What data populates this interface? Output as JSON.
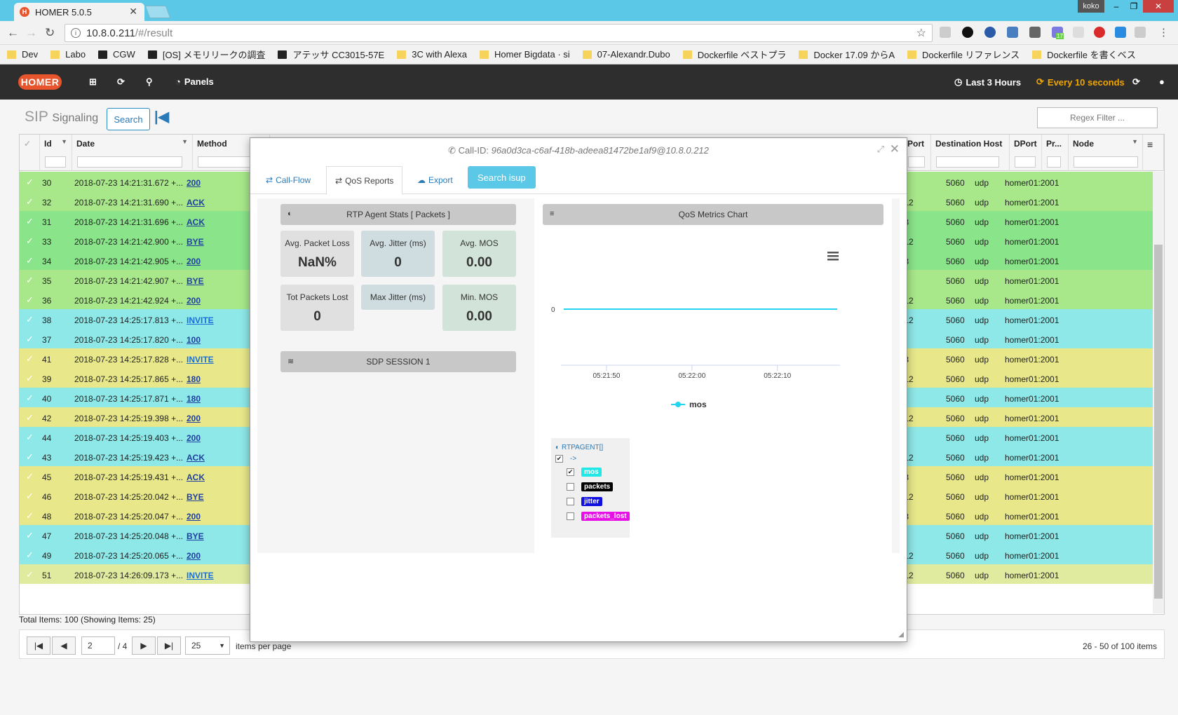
{
  "browser": {
    "tab_title": "HOMER 5.0.5",
    "tab_favicon": "H",
    "user": "koko",
    "url_host": "10.8.0.211",
    "url_path": "/#/result",
    "bookmarks": [
      "Dev",
      "Labo",
      "CGW",
      "[OS] メモリリークの調査",
      "アテッサ CC3015-57E",
      "3C with Alexa",
      "Homer Bigdata · si",
      "07-Alexandr.Dubo",
      "Dockerfile ベストプラ",
      "Docker 17.09 からA",
      "Dockerfile リファレンス",
      "Dockerfile を書くベス"
    ],
    "badge_count": "17"
  },
  "nav": {
    "logo": "HOMER",
    "panels": "Panels",
    "time_range": "Last 3 Hours",
    "refresh": "Every 10 seconds"
  },
  "page": {
    "title": "SIP",
    "subtitle": "Signaling",
    "search_button": "Search",
    "regex_placeholder": "Regex Filter ..."
  },
  "grid": {
    "columns": [
      "Id",
      "Date",
      "Method",
      "Port",
      "Destination Host",
      "DPort",
      "Pr...",
      "Node"
    ],
    "rows": [
      {
        "id": "30",
        "date": "2018-07-23 14:21:31.672 +...",
        "method": "200",
        "port": "060",
        "dhost": "10.8.1.2",
        "dport": "5060",
        "proto": "udp",
        "node": "homer01:2001",
        "color": "#a8e88a"
      },
      {
        "id": "32",
        "date": "2018-07-23 14:21:31.690 +...",
        "method": "ACK",
        "port": "060",
        "dhost": "10.8.0.212",
        "dport": "5060",
        "proto": "udp",
        "node": "homer01:2001",
        "color": "#a8e88a"
      },
      {
        "id": "31",
        "date": "2018-07-23 14:21:31.696 +...",
        "method": "ACK",
        "port": "060",
        "dhost": "10.8.1.58",
        "dport": "5060",
        "proto": "udp",
        "node": "homer01:2001",
        "color": "#8ae48a"
      },
      {
        "id": "33",
        "date": "2018-07-23 14:21:42.900 +...",
        "method": "BYE",
        "port": "5302",
        "dhost": "10.8.0.212",
        "dport": "5060",
        "proto": "udp",
        "node": "homer01:2001",
        "color": "#8ae48a"
      },
      {
        "id": "34",
        "date": "2018-07-23 14:21:42.905 +...",
        "method": "200",
        "port": "060",
        "dhost": "10.8.1.58",
        "dport": "5060",
        "proto": "udp",
        "node": "homer01:2001",
        "color": "#8ae48a"
      },
      {
        "id": "35",
        "date": "2018-07-23 14:21:42.907 +...",
        "method": "BYE",
        "port": "060",
        "dhost": "10.8.1.2",
        "dport": "5060",
        "proto": "udp",
        "node": "homer01:2001",
        "color": "#a8e88a"
      },
      {
        "id": "36",
        "date": "2018-07-23 14:21:42.924 +...",
        "method": "200",
        "port": "060",
        "dhost": "10.8.0.212",
        "dport": "5060",
        "proto": "udp",
        "node": "homer01:2001",
        "color": "#a8e88a"
      },
      {
        "id": "38",
        "date": "2018-07-23 14:25:17.813 +...",
        "method": "INVITE",
        "port": "060",
        "dhost": "10.8.0.212",
        "dport": "5060",
        "proto": "udp",
        "node": "homer01:2001",
        "color": "#8ee8e8"
      },
      {
        "id": "37",
        "date": "2018-07-23 14:25:17.820 +...",
        "method": "100",
        "port": "060",
        "dhost": "10.8.1.2",
        "dport": "5060",
        "proto": "udp",
        "node": "homer01:2001",
        "color": "#8ee8e8"
      },
      {
        "id": "41",
        "date": "2018-07-23 14:25:17.828 +...",
        "method": "INVITE",
        "port": "060",
        "dhost": "10.8.1.58",
        "dport": "5060",
        "proto": "udp",
        "node": "homer01:2001",
        "color": "#e8e88a"
      },
      {
        "id": "39",
        "date": "2018-07-23 14:25:17.865 +...",
        "method": "180",
        "port": "5302",
        "dhost": "10.8.0.212",
        "dport": "5060",
        "proto": "udp",
        "node": "homer01:2001",
        "color": "#e8e88a"
      },
      {
        "id": "40",
        "date": "2018-07-23 14:25:17.871 +...",
        "method": "180",
        "port": "060",
        "dhost": "10.8.1.2",
        "dport": "5060",
        "proto": "udp",
        "node": "homer01:2001",
        "color": "#8ee8e8"
      },
      {
        "id": "42",
        "date": "2018-07-23 14:25:19.398 +...",
        "method": "200",
        "port": "5302",
        "dhost": "10.8.0.212",
        "dport": "5060",
        "proto": "udp",
        "node": "homer01:2001",
        "color": "#e8e88a"
      },
      {
        "id": "44",
        "date": "2018-07-23 14:25:19.403 +...",
        "method": "200",
        "port": "060",
        "dhost": "10.8.1.2",
        "dport": "5060",
        "proto": "udp",
        "node": "homer01:2001",
        "color": "#8ee8e8"
      },
      {
        "id": "43",
        "date": "2018-07-23 14:25:19.423 +...",
        "method": "ACK",
        "port": "060",
        "dhost": "10.8.0.212",
        "dport": "5060",
        "proto": "udp",
        "node": "homer01:2001",
        "color": "#8ee8e8"
      },
      {
        "id": "45",
        "date": "2018-07-23 14:25:19.431 +...",
        "method": "ACK",
        "port": "060",
        "dhost": "10.8.1.58",
        "dport": "5060",
        "proto": "udp",
        "node": "homer01:2001",
        "color": "#e8e88a"
      },
      {
        "id": "46",
        "date": "2018-07-23 14:25:20.042 +...",
        "method": "BYE",
        "port": "5302",
        "dhost": "10.8.0.212",
        "dport": "5060",
        "proto": "udp",
        "node": "homer01:2001",
        "color": "#e8e88a"
      },
      {
        "id": "48",
        "date": "2018-07-23 14:25:20.047 +...",
        "method": "200",
        "port": "060",
        "dhost": "10.8.1.58",
        "dport": "5060",
        "proto": "udp",
        "node": "homer01:2001",
        "color": "#e8e88a"
      },
      {
        "id": "47",
        "date": "2018-07-23 14:25:20.048 +...",
        "method": "BYE",
        "port": "060",
        "dhost": "10.8.1.2",
        "dport": "5060",
        "proto": "udp",
        "node": "homer01:2001",
        "color": "#8ee8e8"
      },
      {
        "id": "49",
        "date": "2018-07-23 14:25:20.065 +...",
        "method": "200",
        "port": "060",
        "dhost": "10.8.0.212",
        "dport": "5060",
        "proto": "udp",
        "node": "homer01:2001",
        "color": "#8ee8e8"
      },
      {
        "id": "51",
        "date": "2018-07-23 14:26:09.173 +...",
        "method": "INVITE",
        "port": "060",
        "dhost": "10.8.0.212",
        "dport": "5060",
        "proto": "udp",
        "node": "homer01:2001",
        "color": "#e0eba0"
      }
    ],
    "total": "Total Items: 100 (Showing Items: 25)",
    "page": "2",
    "of_pages": "/ 4",
    "per_page": "25",
    "per_page_label": "items per page",
    "range": "26 - 50 of 100 items"
  },
  "modal": {
    "callid_label": "Call-ID:",
    "callid": "96a0d3ca-c6af-418b-adeea81472be1af9@10.8.0.212",
    "tabs": {
      "callflow": "Call-Flow",
      "qos": "QoS Reports",
      "export": "Export",
      "isup": "Search isup"
    },
    "rtp_title": "RTP Agent Stats [ Packets ]",
    "stats": [
      {
        "label": "Avg. Packet Loss",
        "value": "NaN%"
      },
      {
        "label": "Avg. Jitter (ms)",
        "value": "0"
      },
      {
        "label": "Avg. MOS",
        "value": "0.00"
      },
      {
        "label": "Tot Packets Lost",
        "value": "0"
      },
      {
        "label": "Max Jitter (ms)",
        "value": ""
      },
      {
        "label": "Min. MOS",
        "value": "0.00"
      }
    ],
    "sdp_title": "SDP SESSION 1",
    "chart_title": "QoS Metrics Chart",
    "legend_box": {
      "title": "RTPAGENT[]",
      "arrow": "->",
      "items": [
        {
          "label": "mos",
          "bg": "#22e8e8",
          "fg": "#ffffff",
          "checked": true
        },
        {
          "label": "packets",
          "bg": "#000000",
          "fg": "#ffffff",
          "checked": false
        },
        {
          "label": "jitter",
          "bg": "#1010e0",
          "fg": "#ffffff",
          "checked": false
        },
        {
          "label": "packets_lost",
          "bg": "#e810e8",
          "fg": "#ffffff",
          "checked": false
        }
      ]
    }
  },
  "chart_data": {
    "type": "line",
    "title": "",
    "x": [
      "05:21:45",
      "05:22:17"
    ],
    "x_ticks": [
      "05:21:50",
      "05:22:00",
      "05:22:10"
    ],
    "series": [
      {
        "name": "mos",
        "values": [
          0,
          0
        ],
        "color": "#22d4f0"
      }
    ],
    "y_ticks": [
      "0"
    ],
    "legend": "bottom"
  }
}
